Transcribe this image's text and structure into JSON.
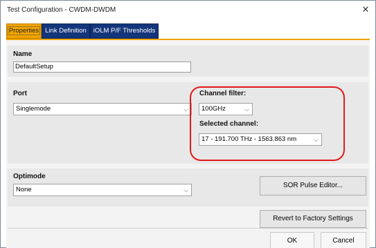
{
  "window": {
    "title": "Test Configuration - CWDM-DWDM",
    "close_glyph": "✕"
  },
  "tabs": [
    {
      "label": "Properties",
      "active": true
    },
    {
      "label": "Link Definition",
      "active": false
    },
    {
      "label": "iOLM P/F Thresholds",
      "active": false
    }
  ],
  "name_section": {
    "label": "Name",
    "value": "DefaultSetup"
  },
  "port_section": {
    "label": "Port",
    "selected": "Singlemode",
    "channel_filter_label": "Channel filter:",
    "channel_filter_value": "100GHz",
    "selected_channel_label": "Selected channel:",
    "selected_channel_value": "17  - 191.700 THz - 1563.863 nm"
  },
  "optimode_section": {
    "label": "Optimode",
    "selected": "None"
  },
  "buttons": {
    "sor_pulse_editor": "SOR Pulse Editor...",
    "revert_factory": "Revert to Factory Settings",
    "ok": "OK",
    "cancel": "Cancel"
  },
  "icons": {
    "chevron": "chevron-down-icon",
    "close": "close-icon"
  },
  "colors": {
    "tab_active": "#f0a400",
    "tab_inactive": "#13357a",
    "highlight_annotation": "#e31818",
    "section_bg": "#e8e8e8"
  }
}
